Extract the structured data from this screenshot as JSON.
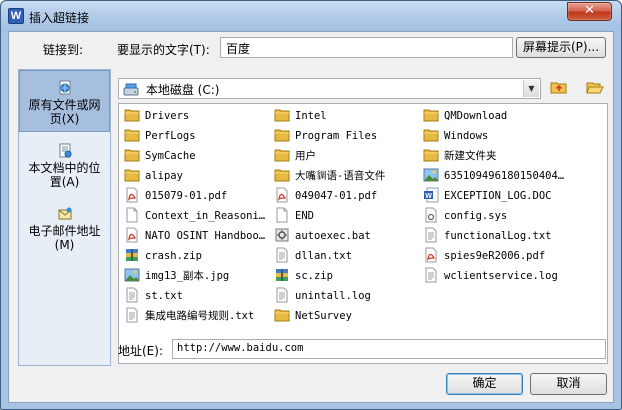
{
  "window": {
    "title": "插入超链接",
    "app_icon_letter": "W",
    "close_glyph": "✕"
  },
  "link_to_label": "链接到:",
  "display_text": {
    "label": "要显示的文字(T):",
    "value": "百度"
  },
  "screentip_button": "屏幕提示(P)...",
  "nav": {
    "items": [
      {
        "label_line1": "原有文件或网",
        "label_line2": "页(X)",
        "icon": "globe-page-icon",
        "active": true
      },
      {
        "label_line1": "本文档中的位",
        "label_line2": "置(A)",
        "icon": "document-place-icon",
        "active": false
      },
      {
        "label_line1": "电子邮件地址",
        "label_line2": "(M)",
        "icon": "email-icon",
        "active": false
      }
    ]
  },
  "location": {
    "value": "本地磁盘 (C:)",
    "icon": "drive-icon"
  },
  "files": [
    {
      "name": "Drivers",
      "type": "folder"
    },
    {
      "name": "PerfLogs",
      "type": "folder"
    },
    {
      "name": "SymCache",
      "type": "folder"
    },
    {
      "name": "alipay",
      "type": "folder"
    },
    {
      "name": "015079-01.pdf",
      "type": "pdf"
    },
    {
      "name": "Context_in_Reasoni…",
      "type": "blank"
    },
    {
      "name": "NATO OSINT Handboo…",
      "type": "pdf"
    },
    {
      "name": "crash.zip",
      "type": "zip"
    },
    {
      "name": "img13_副本.jpg",
      "type": "image"
    },
    {
      "name": "st.txt",
      "type": "text"
    },
    {
      "name": "集成电路编号规则.txt",
      "type": "text"
    },
    {
      "name": "Intel",
      "type": "folder"
    },
    {
      "name": "Program Files",
      "type": "folder"
    },
    {
      "name": "用户",
      "type": "folder"
    },
    {
      "name": "大嘴𧳜语-语音文件",
      "type": "folder"
    },
    {
      "name": "049047-01.pdf",
      "type": "pdf"
    },
    {
      "name": "END",
      "type": "blank"
    },
    {
      "name": "autoexec.bat",
      "type": "bat"
    },
    {
      "name": "dllan.txt",
      "type": "text"
    },
    {
      "name": "sc.zip",
      "type": "zip"
    },
    {
      "name": "unintall.log",
      "type": "text"
    },
    {
      "name": "NetSurvey",
      "type": "folder"
    },
    {
      "name": "QMDownload",
      "type": "folder"
    },
    {
      "name": "Windows",
      "type": "folder"
    },
    {
      "name": "新建文件夹",
      "type": "folder"
    },
    {
      "name": "635109496180150404…",
      "type": "image"
    },
    {
      "name": "EXCEPTION_LOG.DOC",
      "type": "word"
    },
    {
      "name": "config.sys",
      "type": "sys"
    },
    {
      "name": "functionalLog.txt",
      "type": "text"
    },
    {
      "name": "spies9eR2006.pdf",
      "type": "pdf"
    },
    {
      "name": "wclientservice.log",
      "type": "text"
    }
  ],
  "address": {
    "label": "地址(E):",
    "value": "http://www.baidu.com"
  },
  "buttons": {
    "ok": "确定",
    "cancel": "取消"
  },
  "colors": {
    "title_bar": "#b4cdea",
    "close_button": "#c1361a",
    "nav_active": "#a7bfde",
    "folder": "#e8b943",
    "pdf": "#d03a2a"
  }
}
